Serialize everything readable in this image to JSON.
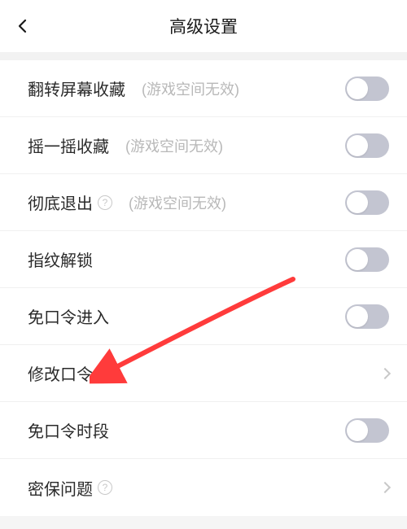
{
  "header": {
    "title": "高级设置"
  },
  "rows": {
    "flipScreen": {
      "title": "翻转屏幕收藏",
      "hint": "(游戏空间无效)"
    },
    "shake": {
      "title": "摇一摇收藏",
      "hint": "(游戏空间无效)"
    },
    "fullExit": {
      "title": "彻底退出",
      "hint": "(游戏空间无效)"
    },
    "fingerprint": {
      "title": "指纹解锁"
    },
    "noPassEnter": {
      "title": "免口令进入"
    },
    "changePass": {
      "title": "修改口令"
    },
    "noPassPeriod": {
      "title": "免口令时段"
    },
    "securityQ": {
      "title": "密保问题"
    }
  },
  "annotation": {
    "arrow_color": "#ff3b3b"
  }
}
